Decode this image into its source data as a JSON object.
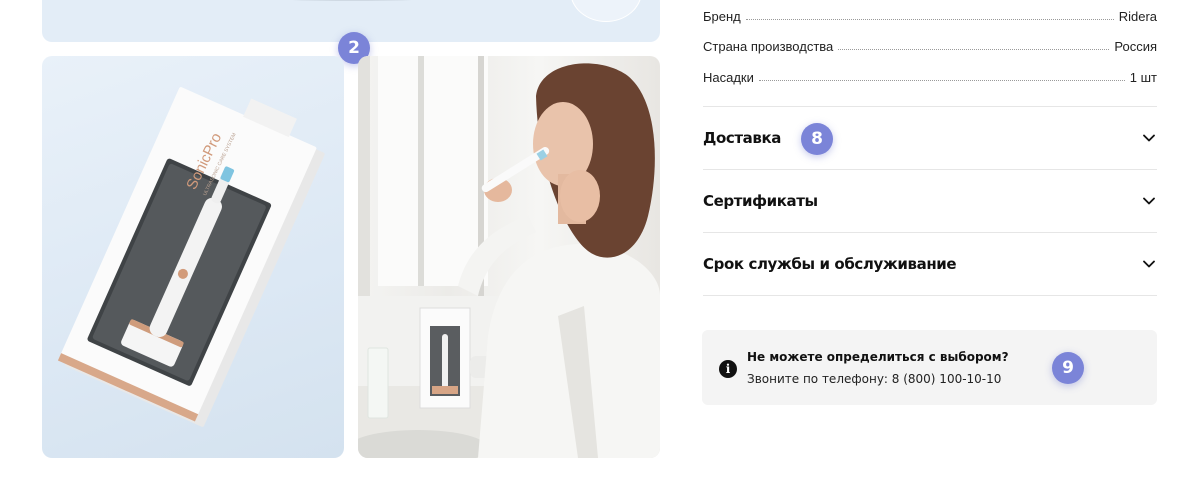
{
  "gallery": {
    "badge_top": "2",
    "box_brand": "SonicPro",
    "box_subtitle": "ULTRASONIC CARE SYSTEM"
  },
  "specs": [
    {
      "label": "Бренд",
      "value": "Ridera"
    },
    {
      "label": "Страна производства",
      "value": "Россия"
    },
    {
      "label": "Насадки",
      "value": "1 шт"
    }
  ],
  "accordion": [
    {
      "title": "Доставка"
    },
    {
      "title": "Сертификаты"
    },
    {
      "title": "Срок службы и обслуживание"
    }
  ],
  "badge_delivery": "8",
  "help": {
    "title": "Не можете определиться с выбором?",
    "text": "Звоните по телефону: 8 (800) 100-10-10",
    "badge": "9"
  },
  "colors": {
    "badge": "#7b84d8",
    "photo_bg": "#e3edf7",
    "help_bg": "#f4f4f4"
  }
}
